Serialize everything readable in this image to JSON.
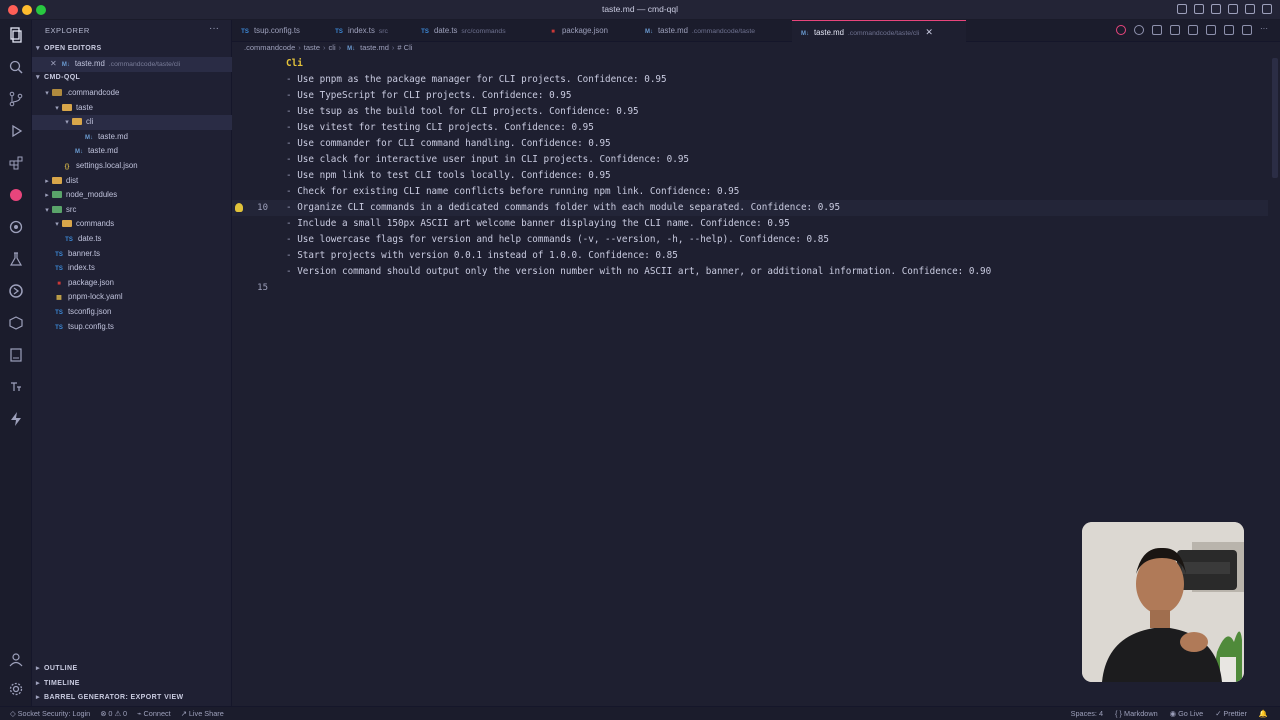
{
  "window": {
    "title": "taste.md — cmd-qql"
  },
  "explorer": {
    "header": "EXPLORER",
    "more": "···",
    "open_editors_label": "OPEN EDITORS",
    "open_editor": {
      "close": "✕",
      "name": "taste.md",
      "desc": ".commandcode/taste/cli"
    },
    "project_label": "CMD-QQL",
    "tree": [
      {
        "label": ".commandcode"
      },
      {
        "label": "taste"
      },
      {
        "label": "cli"
      },
      {
        "label": "taste.md"
      },
      {
        "label": "taste.md"
      },
      {
        "label": "settings.local.json"
      },
      {
        "label": "dist"
      },
      {
        "label": "node_modules"
      },
      {
        "label": "src"
      },
      {
        "label": "commands"
      },
      {
        "label": "date.ts"
      },
      {
        "label": "banner.ts"
      },
      {
        "label": "index.ts"
      },
      {
        "label": "package.json"
      },
      {
        "label": "pnpm-lock.yaml"
      },
      {
        "label": "tsconfig.json"
      },
      {
        "label": "tsup.config.ts"
      }
    ],
    "outline_label": "OUTLINE",
    "timeline_label": "TIMELINE",
    "barrel_label": "BARREL GENERATOR: EXPORT VIEW"
  },
  "tabs": [
    {
      "name": "tsup.config.ts",
      "desc": ""
    },
    {
      "name": "index.ts",
      "desc": "src"
    },
    {
      "name": "date.ts",
      "desc": "src/commands"
    },
    {
      "name": "package.json",
      "desc": ""
    },
    {
      "name": "taste.md",
      "desc": ".commandcode/taste"
    },
    {
      "name": "taste.md",
      "desc": ".commandcode/taste/cli",
      "close": "✕"
    }
  ],
  "breadcrumb": [
    ".commandcode",
    "taste",
    "cli",
    "taste.md",
    "# Cli"
  ],
  "editor": {
    "lines": [
      {
        "num": "",
        "text": "Cli",
        "heading": true
      },
      {
        "num": "",
        "dash": "- ",
        "text": "Use pnpm as the package manager for CLI projects. Confidence: 0.95"
      },
      {
        "num": "",
        "dash": "- ",
        "text": "Use TypeScript for CLI projects. Confidence: 0.95"
      },
      {
        "num": "",
        "dash": "- ",
        "text": "Use tsup as the build tool for CLI projects. Confidence: 0.95"
      },
      {
        "num": "",
        "dash": "- ",
        "text": "Use vitest for testing CLI projects. Confidence: 0.95"
      },
      {
        "num": "",
        "dash": "- ",
        "text": "Use commander for CLI command handling. Confidence: 0.95"
      },
      {
        "num": "",
        "dash": "- ",
        "text": "Use clack for interactive user input in CLI projects. Confidence: 0.95"
      },
      {
        "num": "",
        "dash": "- ",
        "text": "Use npm link to test CLI tools locally. Confidence: 0.95"
      },
      {
        "num": "",
        "dash": "- ",
        "text": "Check for existing CLI name conflicts before running npm link. Confidence: 0.95"
      },
      {
        "num": "10",
        "dash": "- ",
        "text": "Organize CLI commands in a dedicated commands folder with each module separated. Confidence: 0.95"
      },
      {
        "num": "",
        "dash": "- ",
        "text": "Include a small 150px ASCII art welcome banner displaying the CLI name. Confidence: 0.95"
      },
      {
        "num": "",
        "dash": "- ",
        "text": "Use lowercase flags for version and help commands (-v, --version, -h, --help). Confidence: 0.85"
      },
      {
        "num": "",
        "dash": "- ",
        "text": "Start projects with version 0.0.1 instead of 1.0.0. Confidence: 0.85"
      },
      {
        "num": "",
        "dash": "- ",
        "text": "Version command should output only the version number with no ASCII art, banner, or additional information. Confidence: 0.90"
      },
      {
        "num": "15",
        "dash": "",
        "text": ""
      }
    ]
  },
  "status": {
    "socket": "Socket Security: Login",
    "problems": "⊗ 0 ⚠ 0",
    "connect": "Connect",
    "live_share": "Live Share",
    "spaces": "Spaces: 4",
    "language": "Markdown",
    "golive": "Go Live",
    "prettier": "Prettier"
  }
}
